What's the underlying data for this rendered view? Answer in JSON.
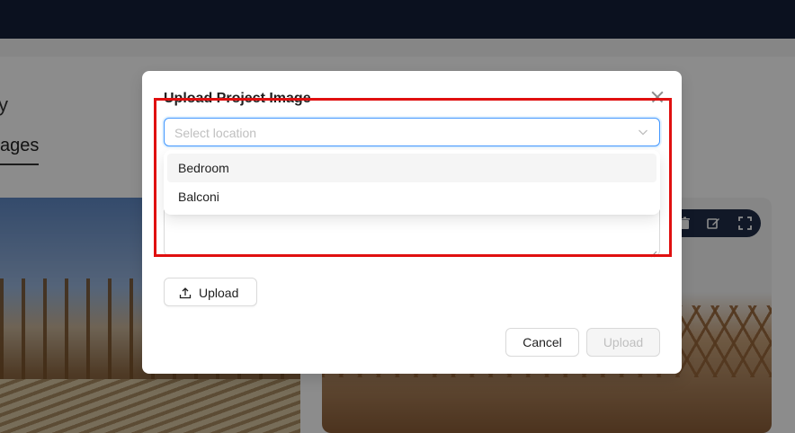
{
  "background": {
    "partial_text": "y",
    "tab_partial": "ages"
  },
  "modal": {
    "title": "Upload Project Image",
    "location_select": {
      "placeholder": "Select location",
      "options": [
        "Bedroom",
        "Balconi"
      ],
      "highlighted_option": "Bedroom"
    },
    "upload_button_label": "Upload",
    "cancel_label": "Cancel",
    "submit_label": "Upload"
  },
  "icons": {
    "close": "close-icon",
    "chevron": "chevron-down-icon",
    "upload": "upload-icon",
    "delete": "trash-icon",
    "edit": "edit-icon",
    "fullscreen": "fullscreen-icon"
  },
  "colors": {
    "topbar": "#142039",
    "focus_border": "#4096ff",
    "highlight_box": "#e01010"
  }
}
